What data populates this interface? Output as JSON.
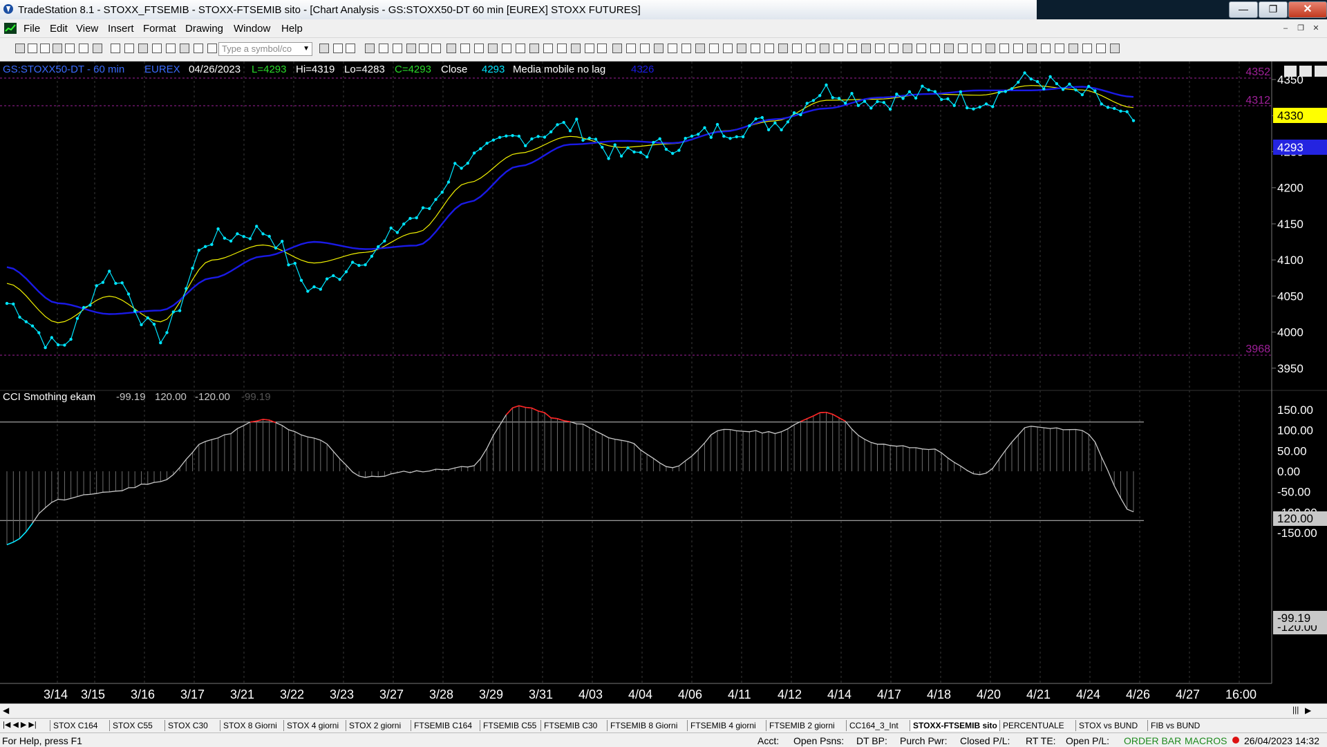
{
  "window": {
    "title": "TradeStation 8.1 - STOXX_FTSEMIB - STOXX-FTSEMIB sito - [Chart Analysis - GS:STOXX50-DT  60 min  [EUREX] STOXX FUTURES]",
    "minimize": "—",
    "restore": "❐",
    "close": "✕"
  },
  "menu": [
    "File",
    "Edit",
    "View",
    "Insert",
    "Format",
    "Drawing",
    "Window",
    "Help"
  ],
  "toolbar": {
    "symbol_placeholder": "Type a symbol/co"
  },
  "chart": {
    "header": {
      "symbol": "GS:STOXX50-DT - 60 min",
      "exchange": "EUREX",
      "date": "04/26/2023",
      "last": "L=4293",
      "high": "Hi=4319",
      "low": "Lo=4283",
      "close": "C=4293",
      "close_label": "Close",
      "close_value": "4293",
      "indicator_name": "Media mobile no lag",
      "indicator_value": "4326"
    },
    "price_axis": [
      "4350",
      "4300",
      "4250",
      "4200",
      "4150",
      "4100",
      "4050",
      "4000",
      "3950"
    ],
    "price_markers": {
      "level_high": "4352",
      "level_mid": "4312",
      "level_low": "3968",
      "badge_yellow": "4330",
      "badge_blue": "4293"
    },
    "sub_header": {
      "name": "CCI Smothing ekam",
      "v1": "-99.19",
      "v2": "120.00",
      "v3": "-120.00",
      "v4": "-99.19"
    },
    "cci_axis": [
      "150.00",
      "100.00",
      "50.00",
      "0.00",
      "-50.00",
      "-100.00",
      "-150.00"
    ],
    "cci_markers": {
      "upper": "120.00",
      "current": "-99.19",
      "lower": "-120.00"
    },
    "dates": [
      "3/14",
      "3/15",
      "3/16",
      "3/17",
      "3/21",
      "3/22",
      "3/23",
      "3/27",
      "3/28",
      "3/29",
      "3/31",
      "4/03",
      "4/04",
      "4/06",
      "4/11",
      "4/12",
      "4/14",
      "4/17",
      "4/18",
      "4/20",
      "4/21",
      "4/24",
      "4/26",
      "4/27",
      "16:00"
    ],
    "colors": {
      "price_line": "#00e5ff",
      "fast_ma": "#f2f200",
      "slow_ma": "#1a1ae6",
      "level_line": "#a0209a",
      "cci": "#c8c8c8",
      "cci_over": "#ff2020"
    }
  },
  "chart_data": {
    "type": "line",
    "x": [
      "3/14",
      "3/15",
      "3/16",
      "3/17",
      "3/21",
      "3/22",
      "3/23",
      "3/27",
      "3/28",
      "3/29",
      "3/31",
      "4/03",
      "4/04",
      "4/06",
      "4/11",
      "4/12",
      "4/14",
      "4/17",
      "4/18",
      "4/20",
      "4/21",
      "4/24",
      "4/26"
    ],
    "series": [
      {
        "name": "Close",
        "values": [
          4040,
          3980,
          4080,
          3995,
          4130,
          4140,
          4060,
          4105,
          4160,
          4240,
          4270,
          4285,
          4245,
          4260,
          4280,
          4290,
          4335,
          4320,
          4330,
          4320,
          4350,
          4330,
          4293
        ]
      },
      {
        "name": "Media mobile no lag",
        "values": [
          4090,
          4040,
          4025,
          4030,
          4075,
          4105,
          4125,
          4115,
          4120,
          4180,
          4230,
          4260,
          4265,
          4262,
          4278,
          4295,
          4310,
          4325,
          4330,
          4335,
          4335,
          4340,
          4326
        ]
      }
    ],
    "ylim": [
      3925,
      4380
    ],
    "cci": {
      "values": [
        -180,
        -70,
        -50,
        -25,
        80,
        125,
        80,
        -15,
        0,
        10,
        160,
        120,
        75,
        10,
        100,
        95,
        145,
        65,
        55,
        -10,
        110,
        100,
        -99
      ],
      "ylim": [
        -175,
        170
      ],
      "thresholds": [
        120,
        -120
      ]
    }
  },
  "tabs": [
    "STOX C164",
    "STOX C55",
    "STOX  C30",
    "STOX  8 Giorni",
    "STOX 4 giorni",
    "STOX  2 giorni",
    "FTSEMIB C164",
    "FTSEMIB C55",
    "FTSEMIB C30",
    "FTSEMIB  8 Giorni",
    "FTSEMIB  4 giorni",
    "FTSEMIB  2 giorni",
    "CC164_3_Int",
    "STOXX-FTSEMIB sito",
    "PERCENTUALE",
    "STOX vs BUND",
    "FIB vs BUND"
  ],
  "active_tab": "STOXX-FTSEMIB sito",
  "status": {
    "help": "For Help, press F1",
    "acct": "Acct:",
    "open_psns": "Open Psns:",
    "dt_bp": "DT BP:",
    "purch_pwr": "Purch Pwr:",
    "closed_pl": "Closed P/L:",
    "rt_te": "RT TE:",
    "open_pl": "Open P/L:",
    "order_bar": "ORDER BAR",
    "macros": "MACROS",
    "datetime": "26/04/2023 14:32"
  }
}
